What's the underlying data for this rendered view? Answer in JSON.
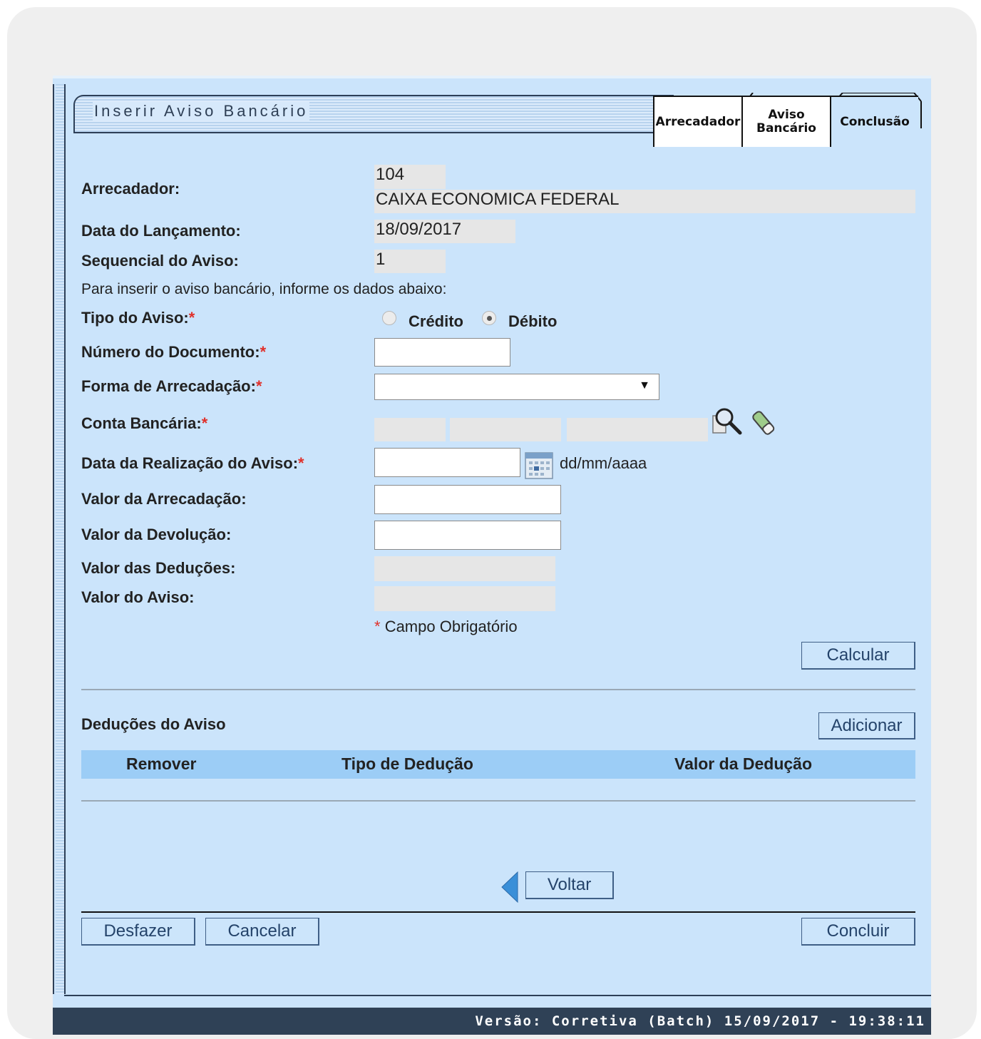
{
  "title": "Inserir Aviso Bancário",
  "tabs": [
    {
      "label": "Arrecadador"
    },
    {
      "label_line1": "Aviso",
      "label_line2": "Bancário"
    },
    {
      "label": "Conclusão"
    }
  ],
  "form": {
    "arrecadador_label": "Arrecadador:",
    "arrecadador_code": "104",
    "arrecadador_name": "CAIXA ECONOMICA FEDERAL",
    "data_lancamento_label": "Data do Lançamento:",
    "data_lancamento_value": "18/09/2017",
    "sequencial_label": "Sequencial do Aviso:",
    "sequencial_value": "1",
    "instructions": "Para inserir o aviso bancário, informe os dados abaixo:",
    "tipo_aviso_label": "Tipo do Aviso:",
    "tipo_credito": "Crédito",
    "tipo_debito": "Débito",
    "numero_documento_label": "Número do Documento:",
    "numero_documento_value": "",
    "forma_arrecadacao_label": "Forma de Arrecadação:",
    "forma_arrecadacao_value": "",
    "conta_bancaria_label": "Conta Bancária:",
    "data_realizacao_label": "Data da Realização do Aviso:",
    "data_realizacao_value": "",
    "data_format_hint": "dd/mm/aaaa",
    "valor_arrecadacao_label": "Valor da Arrecadação:",
    "valor_devolucao_label": "Valor da Devolução:",
    "valor_deducoes_label": "Valor das Deduções:",
    "valor_aviso_label": "Valor do Aviso:",
    "required_marker": "*",
    "required_note": "Campo Obrigatório",
    "calcular_button": "Calcular"
  },
  "deducoes": {
    "section_title": "Deduções do Aviso",
    "adicionar_button": "Adicionar",
    "columns": [
      "Remover",
      "Tipo de Dedução",
      "Valor da Dedução"
    ],
    "rows": []
  },
  "buttons": {
    "voltar": "Voltar",
    "desfazer": "Desfazer",
    "cancelar": "Cancelar",
    "concluir": "Concluir"
  },
  "footer": {
    "version": "Versão: Corretiva (Batch) 15/09/2017 - 19:38:11"
  },
  "colors": {
    "page_bg": "#cbe4fb",
    "footer_bg": "#2f4156",
    "required": "#e0302a",
    "table_header": "#9ccdf6"
  }
}
